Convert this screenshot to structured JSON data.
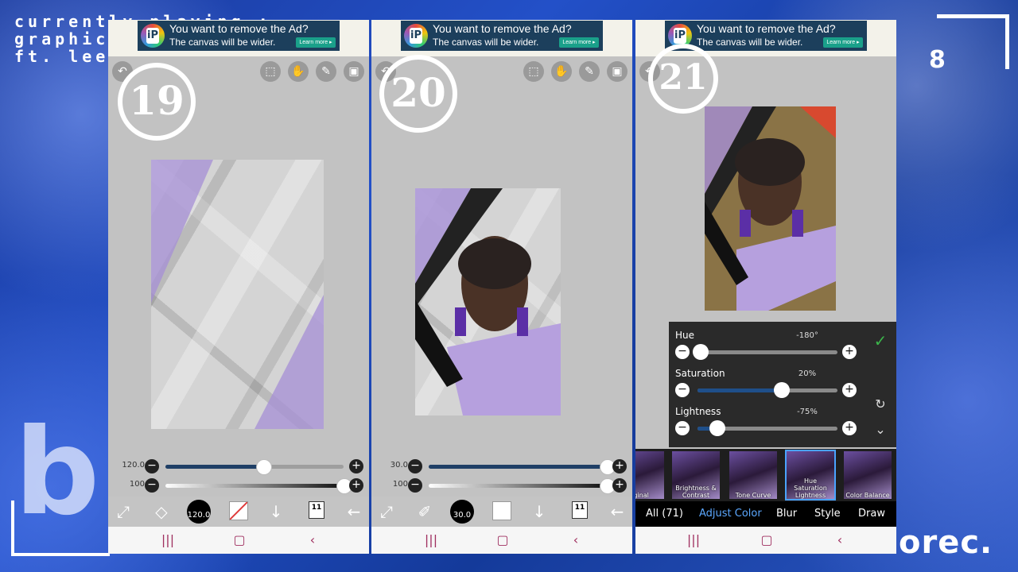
{
  "overlay": {
    "title": "currently playing :\ngraphic\nft. lee",
    "corner_letter": "b",
    "bottom_right": "orec.",
    "deco_number": "8"
  },
  "ad": {
    "logo_text": "iP",
    "headline": "You want to remove the Ad?",
    "subline": "The canvas will be wider.",
    "cta": "Learn more ▸"
  },
  "panels": [
    {
      "step_number": "19",
      "sliders": [
        {
          "label": "120.0",
          "fraction": 0.55
        },
        {
          "label": "100",
          "fraction": 1.0
        }
      ],
      "brush_size": "120.0",
      "layers_count": "11"
    },
    {
      "step_number": "20",
      "sliders": [
        {
          "label": "30.0",
          "fraction": 1.0
        },
        {
          "label": "100",
          "fraction": 1.0
        }
      ],
      "brush_size": "30.0",
      "layers_count": "11"
    },
    {
      "step_number": "21",
      "adjust": {
        "hue": {
          "label": "Hue",
          "value": "-180°",
          "fraction": 0.02
        },
        "saturation": {
          "label": "Saturation",
          "value": "20%",
          "fraction": 0.6
        },
        "lightness": {
          "label": "Lightness",
          "value": "-75%",
          "fraction": 0.14
        }
      },
      "filters": [
        {
          "label": "iginal"
        },
        {
          "label": "Brightness &\nContrast"
        },
        {
          "label": "Tone Curve"
        },
        {
          "label": "Hue\nSaturation\nLightness",
          "selected": true
        },
        {
          "label": "Color Balance"
        }
      ],
      "tabs": [
        {
          "label": "All (71)"
        },
        {
          "label": "Adjust Color",
          "active": true
        },
        {
          "label": "Blur"
        },
        {
          "label": "Style"
        },
        {
          "label": "Draw"
        }
      ]
    }
  ],
  "colors": {
    "accent_blue": "#5ca8ff",
    "slider_fill": "#1f3f66",
    "confirm_green": "#3bb54a",
    "purple": "#a58fd6"
  },
  "icons": {
    "nav": [
      "recent-apps-icon",
      "home-icon",
      "back-icon"
    ],
    "top": [
      "undo-icon",
      "selection-icon",
      "hand-icon",
      "pencil-icon",
      "image-icon"
    ]
  }
}
